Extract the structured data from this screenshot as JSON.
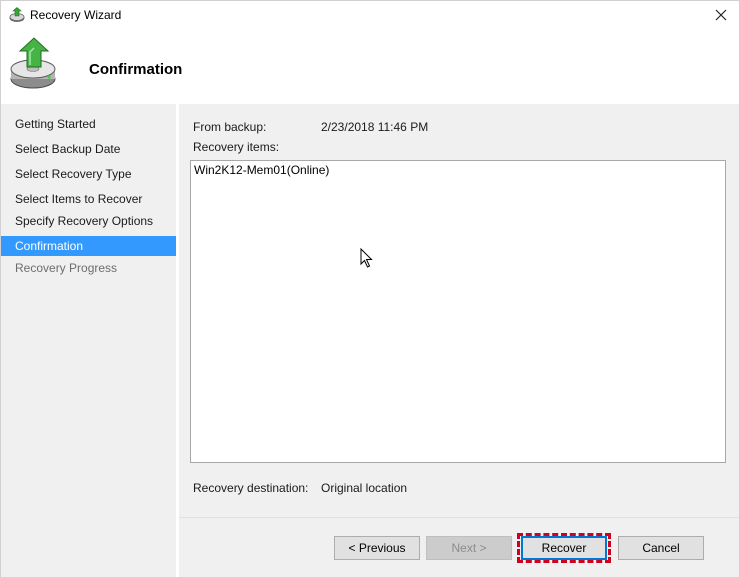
{
  "window": {
    "title": "Recovery Wizard",
    "close_icon": "close-icon"
  },
  "header": {
    "heading": "Confirmation",
    "icon": "backup-restore-icon"
  },
  "nav": {
    "items": [
      {
        "label": "Getting Started",
        "state": "normal"
      },
      {
        "label": "Select Backup Date",
        "state": "normal"
      },
      {
        "label": "Select Recovery Type",
        "state": "normal"
      },
      {
        "label": "Select Items to Recover",
        "state": "normal"
      },
      {
        "label": "Specify Recovery Options",
        "state": "normal"
      },
      {
        "label": "Confirmation",
        "state": "active"
      },
      {
        "label": "Recovery Progress",
        "state": "disabled"
      }
    ]
  },
  "content": {
    "from_backup_label": "From backup:",
    "from_backup_value": "2/23/2018 11:46 PM",
    "recovery_items_label": "Recovery items:",
    "recovery_items": [
      "Win2K12-Mem01(Online)"
    ],
    "recovery_destination_label": "Recovery destination:",
    "recovery_destination_value": "Original location"
  },
  "buttons": {
    "previous": "< Previous",
    "next": "Next >",
    "recover": "Recover",
    "cancel": "Cancel"
  },
  "colors": {
    "active_nav": "#3399ff",
    "highlight": "#d0021b",
    "default_button_border": "#0078d7"
  }
}
